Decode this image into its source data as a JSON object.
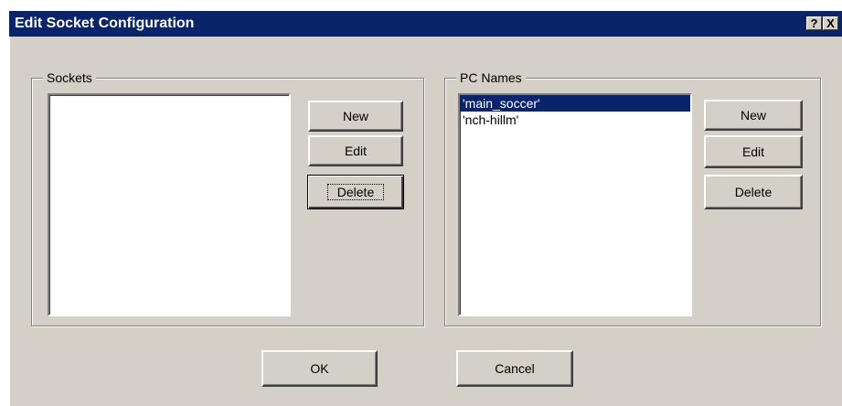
{
  "window": {
    "title": "Edit Socket Configuration",
    "help_label": "?",
    "close_label": "X"
  },
  "sockets": {
    "label": "Sockets",
    "items": [],
    "new_label": "New",
    "edit_label": "Edit",
    "delete_label": "Delete"
  },
  "pc_names": {
    "label": "PC Names",
    "items": [
      "'main_soccer'",
      "'nch-hillm'"
    ],
    "selected_index": 0,
    "new_label": "New",
    "edit_label": "Edit",
    "delete_label": "Delete"
  },
  "footer": {
    "ok_label": "OK",
    "cancel_label": "Cancel"
  },
  "colors": {
    "titlebar": "#0a246a",
    "face": "#d4d0c8",
    "selection": "#0a246a"
  }
}
